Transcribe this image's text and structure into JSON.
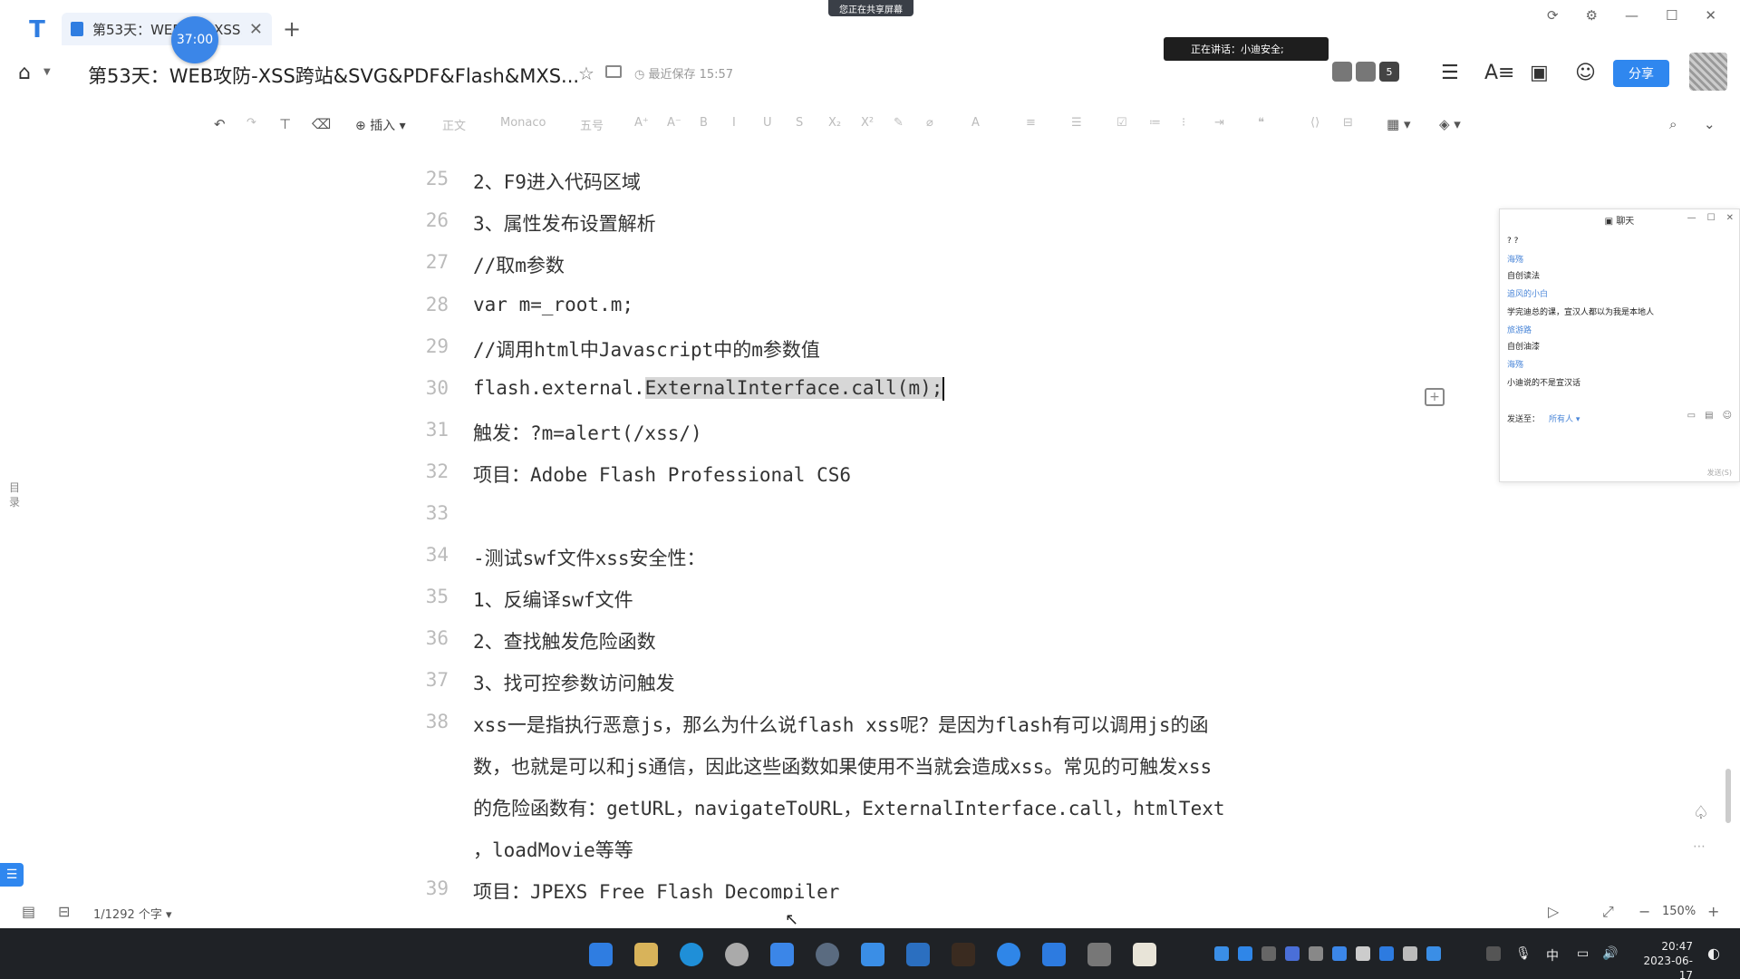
{
  "window": {
    "tab_title": "第53天：WEB攻防-XSS...",
    "timer": "37:00",
    "new_tab": "+",
    "screen_share_banner": "您正在共享屏幕",
    "controls": [
      "⟳",
      "⚙",
      "—",
      "☐",
      "✕"
    ]
  },
  "header": {
    "doc_title": "第53天：WEB攻防-XSS跨站&SVG&PDF&Flash&MXS...",
    "save_status": "最近保存 15:57",
    "speaking_banner": "正在讲话：小迪安全;",
    "avatar_count": "5",
    "share_label": "分享"
  },
  "toolbar": {
    "insert_label": "插入",
    "body_label": "正文",
    "font_label": "Monaco",
    "size_label": "五号"
  },
  "editor": {
    "lines": [
      {
        "num": "25",
        "text": "2、F9进入代码区域"
      },
      {
        "num": "26",
        "text": "3、属性发布设置解析"
      },
      {
        "num": "27",
        "text": "//取m参数"
      },
      {
        "num": "28",
        "text": "var m=_root.m;"
      },
      {
        "num": "29",
        "text": "//调用html中Javascript中的m参数值"
      },
      {
        "num": "30",
        "prefix": "flash.external.",
        "highlight": "ExternalInterface.call(m);"
      },
      {
        "num": "31",
        "text": "触发：?m=alert(/xss/)"
      },
      {
        "num": "32",
        "text": "项目：Adobe Flash Professional CS6"
      },
      {
        "num": "33",
        "text": ""
      },
      {
        "num": "34",
        "text": "-测试swf文件xss安全性："
      },
      {
        "num": "35",
        "text": "1、反编译swf文件"
      },
      {
        "num": "36",
        "text": "2、查找触发危险函数"
      },
      {
        "num": "37",
        "text": "3、找可控参数访问触发"
      },
      {
        "num": "38",
        "text": "xss一是指执行恶意js，那么为什么说flash xss呢？是因为flash有可以调用js的函"
      },
      {
        "num": "",
        "text": "数，也就是可以和js通信，因此这些函数如果使用不当就会造成xss。常见的可触发xss"
      },
      {
        "num": "",
        "text": "的危险函数有：getURL，navigateToURL，ExternalInterface.call，htmlText"
      },
      {
        "num": "",
        "text": "，loadMovie等等"
      },
      {
        "num": "39",
        "text": "项目：JPEXS Free Flash Decompiler"
      }
    ],
    "outline_label": "目录"
  },
  "chat": {
    "title": "聊天",
    "messages": [
      {
        "kind": "text",
        "value": "? ?"
      },
      {
        "kind": "name",
        "value": "海殇"
      },
      {
        "kind": "text",
        "value": "自创读法"
      },
      {
        "kind": "name",
        "value": "追风的小白"
      },
      {
        "kind": "text",
        "value": "学完迪总的课，宣汉人都以为我是本地人"
      },
      {
        "kind": "name",
        "value": "旅游路"
      },
      {
        "kind": "text",
        "value": "自创油漆"
      },
      {
        "kind": "name",
        "value": "海殇"
      },
      {
        "kind": "text",
        "value": "小迪说的不是宣汉话"
      }
    ],
    "send_to_label": "发送至：",
    "send_to_value": "所有人",
    "send_button": "发送(S)"
  },
  "status": {
    "word_count": "1/1292 个字",
    "zoom": "150%"
  },
  "taskbar": {
    "ime": "中",
    "time": "20:47",
    "date": "2023-06-17"
  },
  "colors": {
    "accent": "#2f87ef",
    "highlight": "#d7d7d7",
    "line_number": "#bbbbbb",
    "taskbar": "#1f2226"
  }
}
